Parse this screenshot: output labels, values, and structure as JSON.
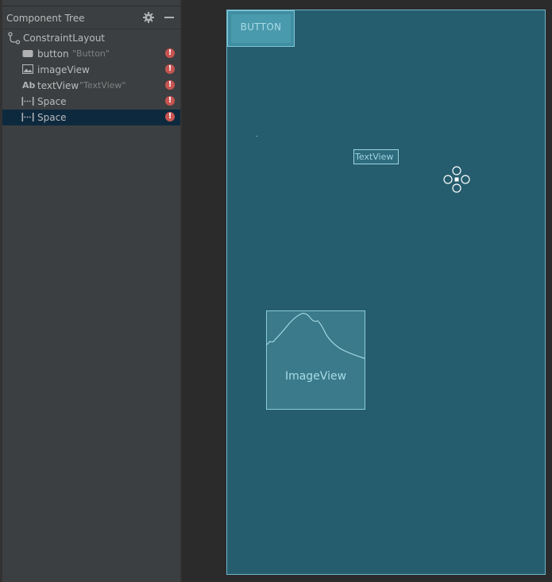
{
  "panel": {
    "title": "Component Tree",
    "icons": [
      "gear-icon",
      "minimize-icon"
    ]
  },
  "tree": {
    "root": {
      "label": "ConstraintLayout",
      "icon": "constraint-layout-icon"
    },
    "items": [
      {
        "label": "button",
        "hint": "\"Button\"",
        "icon": "button-icon",
        "error": true,
        "selected": false
      },
      {
        "label": "imageView",
        "hint": "",
        "icon": "image-icon",
        "error": true,
        "selected": false
      },
      {
        "label": "textView",
        "hint": "\"TextView\"",
        "icon": "text-ab-icon",
        "icon_text": "Ab",
        "error": true,
        "selected": false
      },
      {
        "label": "Space",
        "hint": "",
        "icon": "space-icon",
        "error": true,
        "selected": false
      },
      {
        "label": "Space",
        "hint": "",
        "icon": "space-icon",
        "error": true,
        "selected": true
      }
    ],
    "error_glyph": "!"
  },
  "canvas": {
    "button_label": "BUTTON",
    "textview_label": "TextView",
    "imageview_label": "ImageView"
  },
  "colors": {
    "panel_bg": "#3c3f41",
    "selection": "#0d293e",
    "canvas_bg": "#265d6e",
    "canvas_border": "#6cb4c8",
    "error": "#c75450"
  }
}
